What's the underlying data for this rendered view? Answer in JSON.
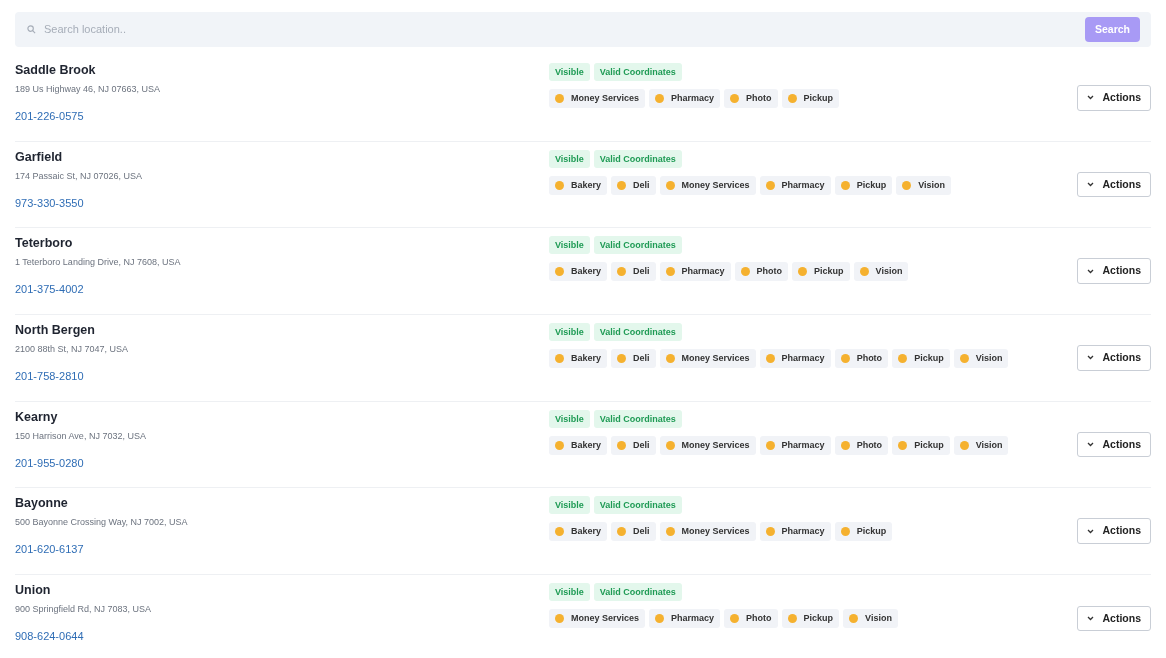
{
  "search": {
    "placeholder": "Search location..",
    "button": "Search"
  },
  "locations": [
    {
      "name": "Saddle Brook",
      "address": "189 Us Highway 46, NJ 07663, USA",
      "phone": "201-226-0575",
      "statuses": [
        "Visible",
        "Valid Coordinates"
      ],
      "services": [
        "Money Services",
        "Pharmacy",
        "Photo",
        "Pickup"
      ],
      "action": "Actions"
    },
    {
      "name": "Garfield",
      "address": "174 Passaic St, NJ 07026, USA",
      "phone": "973-330-3550",
      "statuses": [
        "Visible",
        "Valid Coordinates"
      ],
      "services": [
        "Bakery",
        "Deli",
        "Money Services",
        "Pharmacy",
        "Pickup",
        "Vision"
      ],
      "action": "Actions"
    },
    {
      "name": "Teterboro",
      "address": "1 Teterboro Landing Drive, NJ 7608, USA",
      "phone": "201-375-4002",
      "statuses": [
        "Visible",
        "Valid Coordinates"
      ],
      "services": [
        "Bakery",
        "Deli",
        "Pharmacy",
        "Photo",
        "Pickup",
        "Vision"
      ],
      "action": "Actions"
    },
    {
      "name": "North Bergen",
      "address": "2100 88th St, NJ 7047, USA",
      "phone": "201-758-2810",
      "statuses": [
        "Visible",
        "Valid Coordinates"
      ],
      "services": [
        "Bakery",
        "Deli",
        "Money Services",
        "Pharmacy",
        "Photo",
        "Pickup",
        "Vision"
      ],
      "action": "Actions"
    },
    {
      "name": "Kearny",
      "address": "150 Harrison Ave, NJ 7032, USA",
      "phone": "201-955-0280",
      "statuses": [
        "Visible",
        "Valid Coordinates"
      ],
      "services": [
        "Bakery",
        "Deli",
        "Money Services",
        "Pharmacy",
        "Photo",
        "Pickup",
        "Vision"
      ],
      "action": "Actions"
    },
    {
      "name": "Bayonne",
      "address": "500 Bayonne Crossing Way, NJ 7002, USA",
      "phone": "201-620-6137",
      "statuses": [
        "Visible",
        "Valid Coordinates"
      ],
      "services": [
        "Bakery",
        "Deli",
        "Money Services",
        "Pharmacy",
        "Pickup"
      ],
      "action": "Actions"
    },
    {
      "name": "Union",
      "address": "900 Springfield Rd, NJ 7083, USA",
      "phone": "908-624-0644",
      "statuses": [
        "Visible",
        "Valid Coordinates"
      ],
      "services": [
        "Money Services",
        "Pharmacy",
        "Photo",
        "Pickup",
        "Vision"
      ],
      "action": "Actions"
    }
  ]
}
